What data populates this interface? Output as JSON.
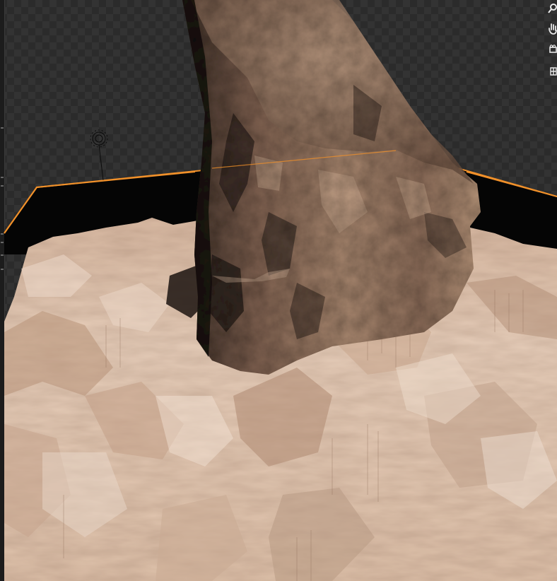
{
  "viewport": {
    "mode": "rendered",
    "background": "transparent-checker",
    "selection_outline_color": "#f0902a"
  },
  "scene": {
    "objects": [
      "rock-pillar",
      "sand-terrain-plane",
      "light-empty"
    ]
  },
  "navigation_gizmo": {
    "icons": [
      "zoom-icon",
      "pan-hand-icon",
      "camera-view-icon",
      "perspective-grid-icon"
    ]
  },
  "colors": {
    "sand_light": "#e3c8b3",
    "sand_mid": "#c9a58c",
    "sand_dark": "#8f6e5a",
    "rock_light": "#b08c74",
    "rock_mid": "#7d5e4b",
    "rock_dark": "#2e2420",
    "outline": "#f0902a"
  }
}
